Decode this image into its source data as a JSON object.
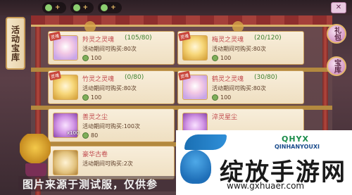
{
  "side_tab": {
    "label": "活动宝库"
  },
  "topbar": {
    "resources": [
      {
        "icon": "jade-coin-icon",
        "plus": "+"
      },
      {
        "icon": "jade-coin-icon",
        "plus": "+"
      },
      {
        "icon": "jade-coin-icon",
        "plus": "+"
      }
    ]
  },
  "right_buttons": {
    "gift": "礼包",
    "bank": "宝库"
  },
  "cards": [
    {
      "name": "羚灵之灵魂",
      "count": "(105/80)",
      "limit": "活动期间可购买:80次",
      "price": "100",
      "tag": "灵魂"
    },
    {
      "name": "梅灵之灵魂",
      "count": "(20/120)",
      "limit": "活动期间可购买:80次",
      "price": "100",
      "tag": "灵魂"
    },
    {
      "name": "竹灵之灵魂",
      "count": "(0/80)",
      "limit": "活动期间可购买:80次",
      "price": "100",
      "tag": "灵魂"
    },
    {
      "name": "鹤灵之灵魂",
      "count": "(30/80)",
      "limit": "活动期间可购买:80次",
      "price": "100",
      "tag": "灵魂"
    },
    {
      "name": "善灵之尘",
      "count": "",
      "limit": "活动期间可购买:100次",
      "price": "80",
      "tag": "",
      "mult": "x100"
    },
    {
      "name": "淬灵星尘",
      "count": "",
      "limit": "",
      "price": "",
      "tag": ""
    },
    {
      "name": "豪华古卷",
      "count": "",
      "limit": "活动期间可购买:2次",
      "price": "",
      "tag": ""
    }
  ],
  "watermark": "图片来源于测试服，仅供参",
  "logo": {
    "brand": "QHYX",
    "brand_sub": "QINHANYOUXI",
    "title": "绽放手游网",
    "url": "www.gxhuaer.com"
  },
  "colors": {
    "name": "#c0474b",
    "count": "#3d7f2d",
    "frame": "#c89c57",
    "awning": "#8e2e2d"
  }
}
